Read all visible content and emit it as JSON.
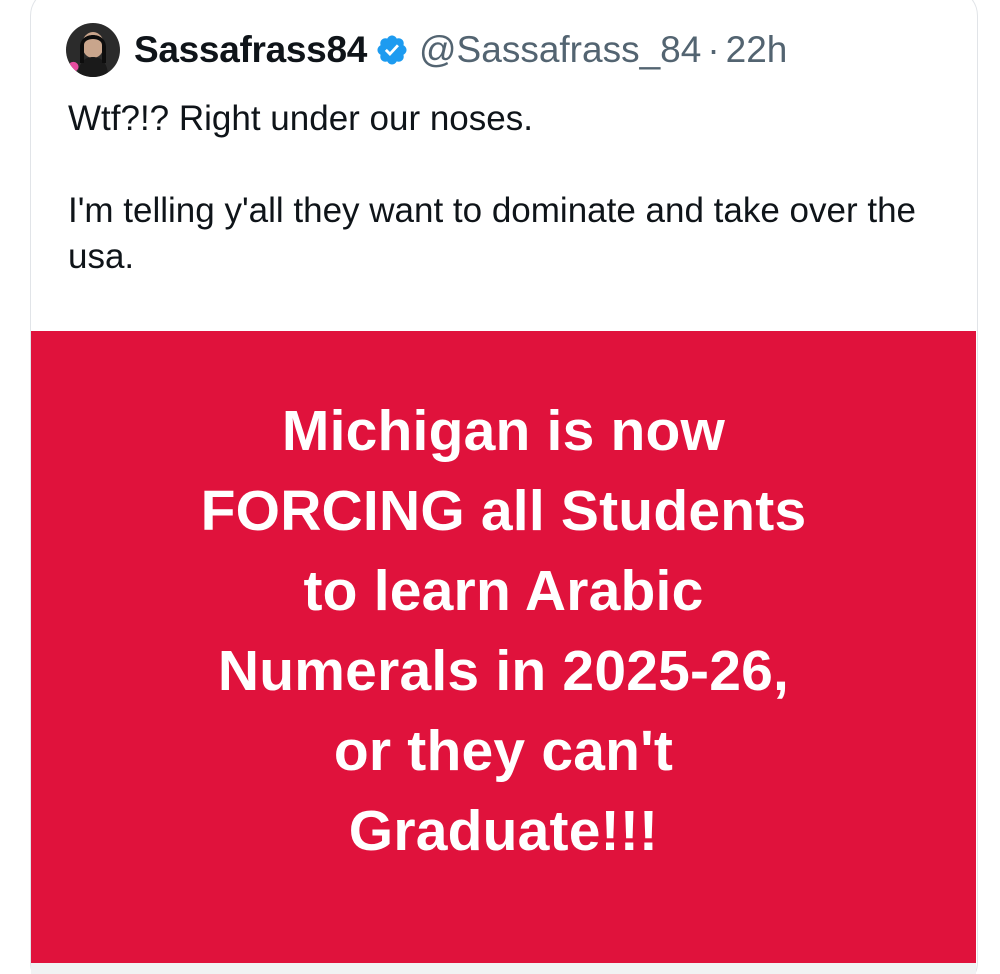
{
  "author": {
    "display_name": "Sassafrass84",
    "handle": "@Sassafrass_84",
    "separator": "·",
    "time_ago": "22h",
    "verified_color": "#1d9bf0",
    "avatar_icon": "profile-photo"
  },
  "tweet": {
    "paragraph_1": "Wtf?!? Right under our noses.",
    "paragraph_2": "I'm telling y'all they want to dominate and take over the usa."
  },
  "media": {
    "background_color": "#e0123c",
    "lines": [
      "Michigan is now",
      "FORCING all Students",
      "to learn Arabic",
      "Numerals in 2025-26,",
      "or they can't",
      "Graduate!!!"
    ]
  }
}
